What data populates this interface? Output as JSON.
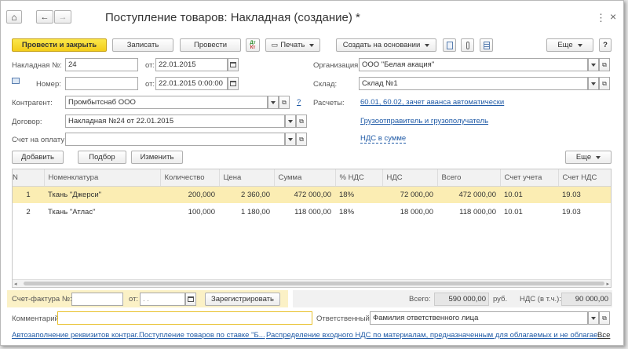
{
  "window": {
    "title": "Поступление товаров: Накладная (создание) *",
    "close_glyph": "×",
    "more_glyph": "⋮"
  },
  "nav": {
    "home": "⌂",
    "back": "←",
    "forward": "→"
  },
  "toolbar": {
    "post_close": "Провести и закрыть",
    "save": "Записать",
    "post": "Провести",
    "print": "Печать",
    "create_based": "Создать на основании",
    "more": "Еще",
    "help": "?"
  },
  "form": {
    "invoice_no_label": "Накладная №:",
    "invoice_no": "24",
    "from_label": "от:",
    "date": "22.01.2015",
    "number_label": "Номер:",
    "number_value": "",
    "datetime": "22.01.2015  0:00:00",
    "contractor_label": "Контрагент:",
    "contractor": "Промбытснаб ООО",
    "contract_label": "Договор:",
    "contract": "Накладная №24 от 22.01.2015",
    "bill_label": "Счет на оплату:",
    "bill": "",
    "org_label": "Организация:",
    "org": "ООО \"Белая акация\"",
    "warehouse_label": "Склад:",
    "warehouse": "Склад №1",
    "settlements_label": "Расчеты:",
    "settlements_link": "60.01, 60.02, зачет аванса автоматически",
    "shipper_link": "Грузоотправитель и грузополучатель",
    "vat_link": "НДС в сумме",
    "question": "?"
  },
  "table_toolbar": {
    "add": "Добавить",
    "select": "Подбор",
    "change": "Изменить",
    "more": "Еще"
  },
  "table": {
    "columns": [
      "N",
      "Номенклатура",
      "Количество",
      "Цена",
      "Сумма",
      "% НДС",
      "НДС",
      "Всего",
      "Счет учета",
      "Счет НДС"
    ],
    "rows": [
      [
        "1",
        "Ткань \"Джерси\"",
        "200,000",
        "2 360,00",
        "472 000,00",
        "18%",
        "72 000,00",
        "472 000,00",
        "10.01",
        "19.03"
      ],
      [
        "2",
        "Ткань \"Атлас\"",
        "100,000",
        "1 180,00",
        "118 000,00",
        "18%",
        "18 000,00",
        "118 000,00",
        "10.01",
        "19.03"
      ]
    ]
  },
  "footer": {
    "invoice_label": "Счет-фактура №:",
    "invoice_no": "",
    "from_label": "от:",
    "invoice_date": " .  .",
    "register": "Зарегистрировать",
    "total_label": "Всего:",
    "total": "590 000,00",
    "currency": "руб.",
    "vat_label": "НДС (в т.ч.):",
    "vat": "90 000,00",
    "comment_label": "Комментарий:",
    "comment": "",
    "responsible_label": "Ответственный:",
    "responsible": "Фамилия ответственного лица"
  },
  "bottom_links": {
    "autofill": "Автозаполнение реквизитов контраг...",
    "receipt": "Поступление товаров по ставке \"Б...",
    "distribution": "Распределение входного НДС по материалам, предназначенным для облагаемых и не облагае...",
    "all": "Все"
  }
}
